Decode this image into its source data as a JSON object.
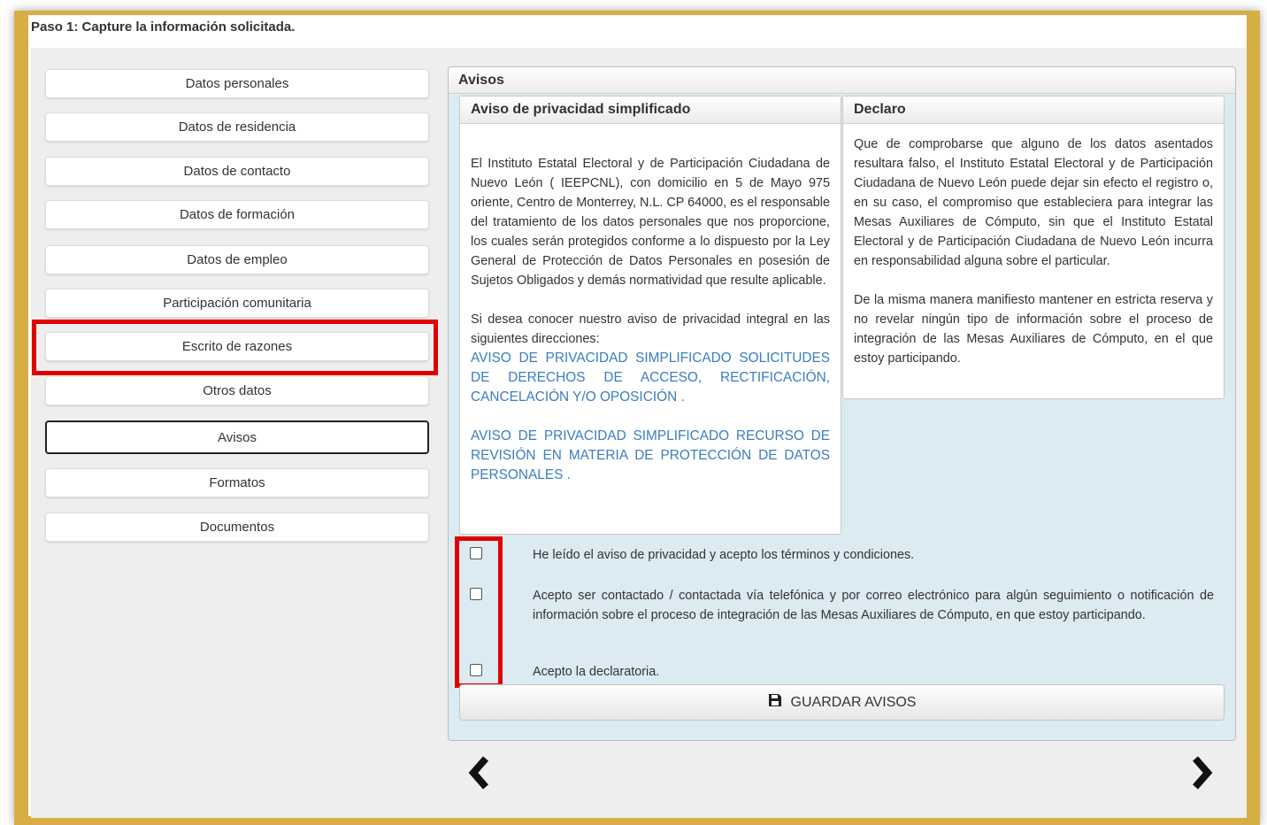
{
  "step_title": "Paso 1: Capture la información solicitada.",
  "nav": {
    "items": [
      {
        "label": "Datos personales"
      },
      {
        "label": "Datos de residencia"
      },
      {
        "label": "Datos de contacto"
      },
      {
        "label": "Datos de formación"
      },
      {
        "label": "Datos de empleo"
      },
      {
        "label": "Participación comunitaria"
      },
      {
        "label": "Escrito de razones"
      },
      {
        "label": "Otros datos"
      },
      {
        "label": "Avisos"
      },
      {
        "label": "Formatos"
      },
      {
        "label": "Documentos"
      }
    ],
    "active": "Avisos"
  },
  "panel": {
    "title": "Avisos",
    "privacy": {
      "title": "Aviso de privacidad simplificado",
      "paragraph1": "El Instituto Estatal Electoral y de Participación Ciudadana de Nuevo León ( IEEPCNL), con domicilio en 5 de Mayo 975 oriente, Centro de Monterrey, N.L. CP 64000, es el responsable del tratamiento de los datos personales que nos proporcione, los cuales serán protegidos conforme a lo dispuesto por la Ley General de Protección de Datos Personales en posesión de Sujetos Obligados y demás normatividad que resulte aplicable.",
      "paragraph2": "Si desea conocer nuestro aviso de privacidad integral en las siguientes direcciones:",
      "link1": "AVISO DE PRIVACIDAD SIMPLIFICADO SOLICITUDES DE DERECHOS DE ACCESO, RECTIFICACIÓN, CANCELACIÓN Y/O OPOSICIÓN .",
      "link2": "AVISO DE PRIVACIDAD SIMPLIFICADO RECURSO DE REVISIÓN EN MATERIA DE PROTECCIÓN DE DATOS PERSONALES ."
    },
    "declaro": {
      "title": "Declaro",
      "paragraph1": "Que de comprobarse que alguno de los datos asentados resultara falso, el Instituto Estatal Electoral y de Participación Ciudadana de Nuevo León puede dejar sin efecto el registro o, en su caso, el compromiso que estableciera para integrar las Mesas Auxiliares de Cómputo, sin que el Instituto Estatal Electoral y de Participación Ciudadana de Nuevo León incurra en responsabilidad alguna sobre el particular.",
      "paragraph2": "De la misma manera manifiesto mantener en estricta reserva y no revelar ningún tipo de información sobre el proceso de integración de las Mesas Auxiliares de Cómputo, en el que estoy participando."
    },
    "checks": [
      {
        "label": "He leído el aviso de privacidad y acepto los términos y condiciones.",
        "checked": false
      },
      {
        "label": "Acepto ser contactado / contactada vía telefónica y por correo electrónico para algún seguimiento o notificación de información sobre el proceso de integración de las Mesas Auxiliares de Cómputo, en que estoy participando.",
        "checked": false
      },
      {
        "label": "Acepto la declaratoria.",
        "checked": false
      }
    ],
    "save_label": "GUARDAR AVISOS",
    "save_icon": "floppy-disk-icon"
  },
  "navigation": {
    "prev_icon": "chevron-left-icon",
    "next_icon": "chevron-right-icon"
  },
  "colors": {
    "frame": "#d6ae44",
    "highlight": "#e00000",
    "panel_bg": "#dcebf2",
    "link": "#3a7ec0"
  }
}
